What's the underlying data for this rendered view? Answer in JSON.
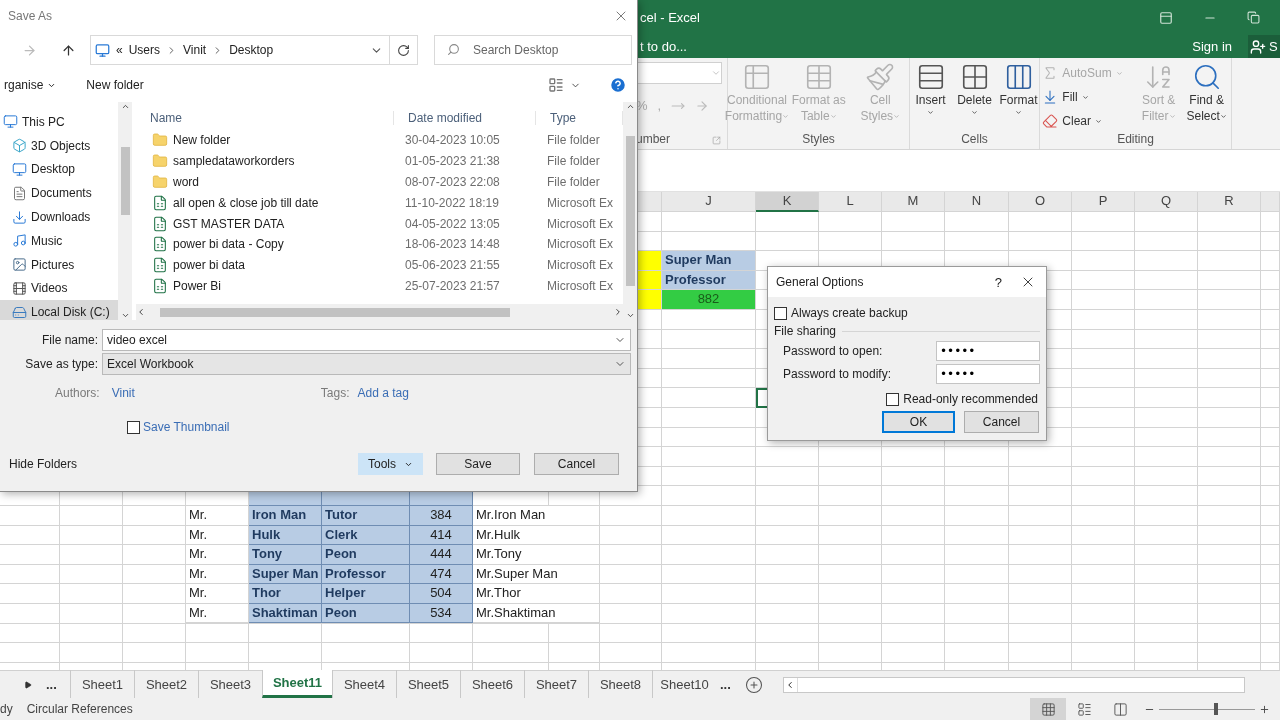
{
  "excel": {
    "title": "cel - Excel",
    "tell_me": "t to do...",
    "sign_in": "Sign in",
    "share": "S",
    "ribbon": {
      "number": {
        "label": "umber",
        "symbols": [
          "%",
          ","
        ]
      },
      "styles": {
        "label": "Styles",
        "buttons": [
          {
            "kind": "conditional",
            "lines": [
              "Conditional",
              "Formatting"
            ],
            "disabled": true
          },
          {
            "kind": "table",
            "lines": [
              "Format as",
              "Table"
            ],
            "disabled": true
          },
          {
            "kind": "styles",
            "lines": [
              "Cell",
              "Styles"
            ],
            "disabled": true
          }
        ]
      },
      "cells": {
        "label": "Cells",
        "buttons": [
          {
            "kind": "insert",
            "lines": [
              "Insert"
            ],
            "disabled": false
          },
          {
            "kind": "delete",
            "lines": [
              "Delete"
            ],
            "disabled": false
          },
          {
            "kind": "format",
            "lines": [
              "Format"
            ],
            "disabled": false
          }
        ]
      },
      "editing": {
        "label": "Editing",
        "small": [
          {
            "kind": "autosum",
            "label": "AutoSum",
            "disabled": true
          },
          {
            "kind": "fill",
            "label": "Fill",
            "disabled": false
          },
          {
            "kind": "clear",
            "label": "Clear",
            "disabled": false
          }
        ],
        "big": [
          {
            "kind": "sort",
            "lines": [
              "Sort &",
              "Filter"
            ],
            "disabled": true
          },
          {
            "kind": "find",
            "lines": [
              "Find &",
              "Select"
            ],
            "disabled": false
          }
        ]
      }
    },
    "column_headers": [
      {
        "label": "J",
        "selected": false
      },
      {
        "label": "K",
        "selected": true
      },
      {
        "label": "L",
        "selected": false
      },
      {
        "label": "M",
        "selected": false
      },
      {
        "label": "N",
        "selected": false
      },
      {
        "label": "O",
        "selected": false
      },
      {
        "label": "P",
        "selected": false
      },
      {
        "label": "Q",
        "selected": false
      },
      {
        "label": "R",
        "selected": false
      }
    ],
    "upper_rows": [
      {
        "kind": "header",
        "value": "Super Man"
      },
      {
        "kind": "header",
        "value": "Professor"
      },
      {
        "kind": "total",
        "value": "882"
      }
    ],
    "lower_rows": [
      {
        "kind": "covered"
      },
      {
        "title": "Mr.",
        "name": "Iron Man",
        "job": "Tutor",
        "number": "384",
        "full_name": "Mr.Iron Man"
      },
      {
        "title": "Mr.",
        "name": "Hulk",
        "job": "Clerk",
        "number": "414",
        "full_name": "Mr.Hulk"
      },
      {
        "title": "Mr.",
        "name": "Tony",
        "job": "Peon",
        "number": "444",
        "full_name": "Mr.Tony"
      },
      {
        "title": "Mr.",
        "name": "Super Man",
        "job": "Professor",
        "number": "474",
        "full_name": "Mr.Super Man"
      },
      {
        "title": "Mr.",
        "name": "Thor",
        "job": "Helper",
        "number": "504",
        "full_name": "Mr.Thor"
      },
      {
        "title": "Mr.",
        "name": "Shaktiman",
        "job": "Peon",
        "number": "534",
        "full_name": "Mr.Shaktiman"
      }
    ],
    "tabs_more_left": "...",
    "tabs_more_right": "...",
    "sheet_tabs": [
      {
        "label": "Sheet1",
        "selected": false
      },
      {
        "label": "Sheet2",
        "selected": false
      },
      {
        "label": "Sheet3",
        "selected": false
      },
      {
        "label": "Sheet11",
        "selected": true
      },
      {
        "label": "Sheet4",
        "selected": false
      },
      {
        "label": "Sheet5",
        "selected": false
      },
      {
        "label": "Sheet6",
        "selected": false
      },
      {
        "label": "Sheet7",
        "selected": false
      },
      {
        "label": "Sheet8",
        "selected": false
      },
      {
        "label": "Sheet10",
        "selected": false
      }
    ],
    "status": {
      "mode": "dy",
      "message": "Circular References",
      "views": [
        {
          "kind": "normal",
          "selected": true
        },
        {
          "kind": "layout",
          "selected": false
        },
        {
          "kind": "break",
          "selected": false
        }
      ],
      "zoom": {
        "level": 0.59
      }
    }
  },
  "save_as": {
    "title": "Save As",
    "path_prefix": "«",
    "path": [
      "Users",
      "Vinit",
      "Desktop"
    ],
    "search_placeholder": "Search Desktop",
    "organise": "rganise",
    "new_folder": "New folder",
    "nav": [
      {
        "label": "This PC",
        "kind": "pc",
        "selected": false,
        "children": [
          {
            "label": "3D Objects",
            "kind": "objects",
            "selected": false
          },
          {
            "label": "Desktop",
            "kind": "desktop",
            "selected": false
          },
          {
            "label": "Documents",
            "kind": "documents",
            "selected": false
          },
          {
            "label": "Downloads",
            "kind": "downloads",
            "selected": false
          },
          {
            "label": "Music",
            "kind": "music",
            "selected": false
          },
          {
            "label": "Pictures",
            "kind": "pictures",
            "selected": false
          },
          {
            "label": "Videos",
            "kind": "videos",
            "selected": false
          },
          {
            "label": "Local Disk (C:)",
            "kind": "disk",
            "selected": true
          }
        ]
      }
    ],
    "columns": [
      "Name",
      "Date modified",
      "Type"
    ],
    "files": [
      {
        "kind": "folder",
        "name": "New folder",
        "date": "30-04-2023 10:05",
        "type": "File folder"
      },
      {
        "kind": "folder",
        "name": "sampledataworkorders",
        "date": "01-05-2023 21:38",
        "type": "File folder"
      },
      {
        "kind": "folder",
        "name": "word",
        "date": "08-07-2023 22:08",
        "type": "File folder"
      },
      {
        "kind": "excel",
        "name": "all open & close job till date",
        "date": "11-10-2022 18:19",
        "type": "Microsoft Ex"
      },
      {
        "kind": "excel",
        "name": "GST MASTER DATA",
        "date": "04-05-2022 13:05",
        "type": "Microsoft Ex"
      },
      {
        "kind": "excel",
        "name": "power bi data - Copy",
        "date": "18-06-2023 14:48",
        "type": "Microsoft Ex"
      },
      {
        "kind": "excel",
        "name": "power bi data",
        "date": "05-06-2023 21:55",
        "type": "Microsoft Ex"
      },
      {
        "kind": "excel",
        "name": "Power Bi",
        "date": "25-07-2023 21:57",
        "type": "Microsoft Ex"
      }
    ],
    "file_name_label": "File name:",
    "file_name": "video excel",
    "type_label": "Save as type:",
    "type": "Excel Workbook",
    "authors_label": "Authors:",
    "author": "Vinit",
    "tags_label": "Tags:",
    "tags": "Add a tag",
    "thumbnail": {
      "label": "Save Thumbnail",
      "checked": false
    },
    "hide_folders": "Hide Folders",
    "tools": "Tools",
    "save": "Save",
    "cancel": "Cancel"
  },
  "general_options": {
    "title": "General Options",
    "help": "?",
    "backup": {
      "label": "Always create backup",
      "checked": false
    },
    "group": "File sharing",
    "fields": [
      {
        "label": "Password to open:",
        "value": "•••••"
      },
      {
        "label": "Password to modify:",
        "value": "•••••"
      }
    ],
    "read_only": {
      "label": "Read-only recommended",
      "checked": false
    },
    "buttons": [
      {
        "label": "OK",
        "selected": true
      },
      {
        "label": "Cancel",
        "selected": false
      }
    ]
  }
}
